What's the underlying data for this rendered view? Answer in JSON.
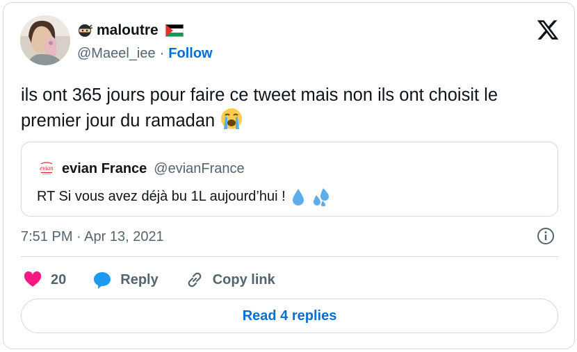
{
  "author": {
    "display_name": "maloutre",
    "handle": "@Maeel_iee",
    "separator": "·",
    "follow_label": "Follow",
    "name_emoji_icon": "ninja-icon",
    "flag_icon": "palestine-flag-icon"
  },
  "tweet": {
    "text": "ils ont 365 jours pour faire ce tweet mais non ils ont choisit le premier jour du ramadan",
    "trailing_emoji_icon": "loudly-crying-face-icon",
    "timestamp": "7:51 PM · Apr 13, 2021"
  },
  "quoted": {
    "display_name": "evian France",
    "handle": "@evianFrance",
    "text": "RT Si vous avez déjà bu 1L aujourd’hui !",
    "logo_text": "evian",
    "emoji_icons": [
      "droplet-icon",
      "sweat-droplets-icon"
    ]
  },
  "actions": {
    "like_count": "20",
    "reply_label": "Reply",
    "copy_link_label": "Copy link"
  },
  "read_replies_label": "Read 4 replies",
  "colors": {
    "accent": "#006fd6",
    "like": "#f91880",
    "reply_icon": "#1d9bf0",
    "text": "#0f1419",
    "secondary": "#536471",
    "border": "#cfd9de"
  }
}
